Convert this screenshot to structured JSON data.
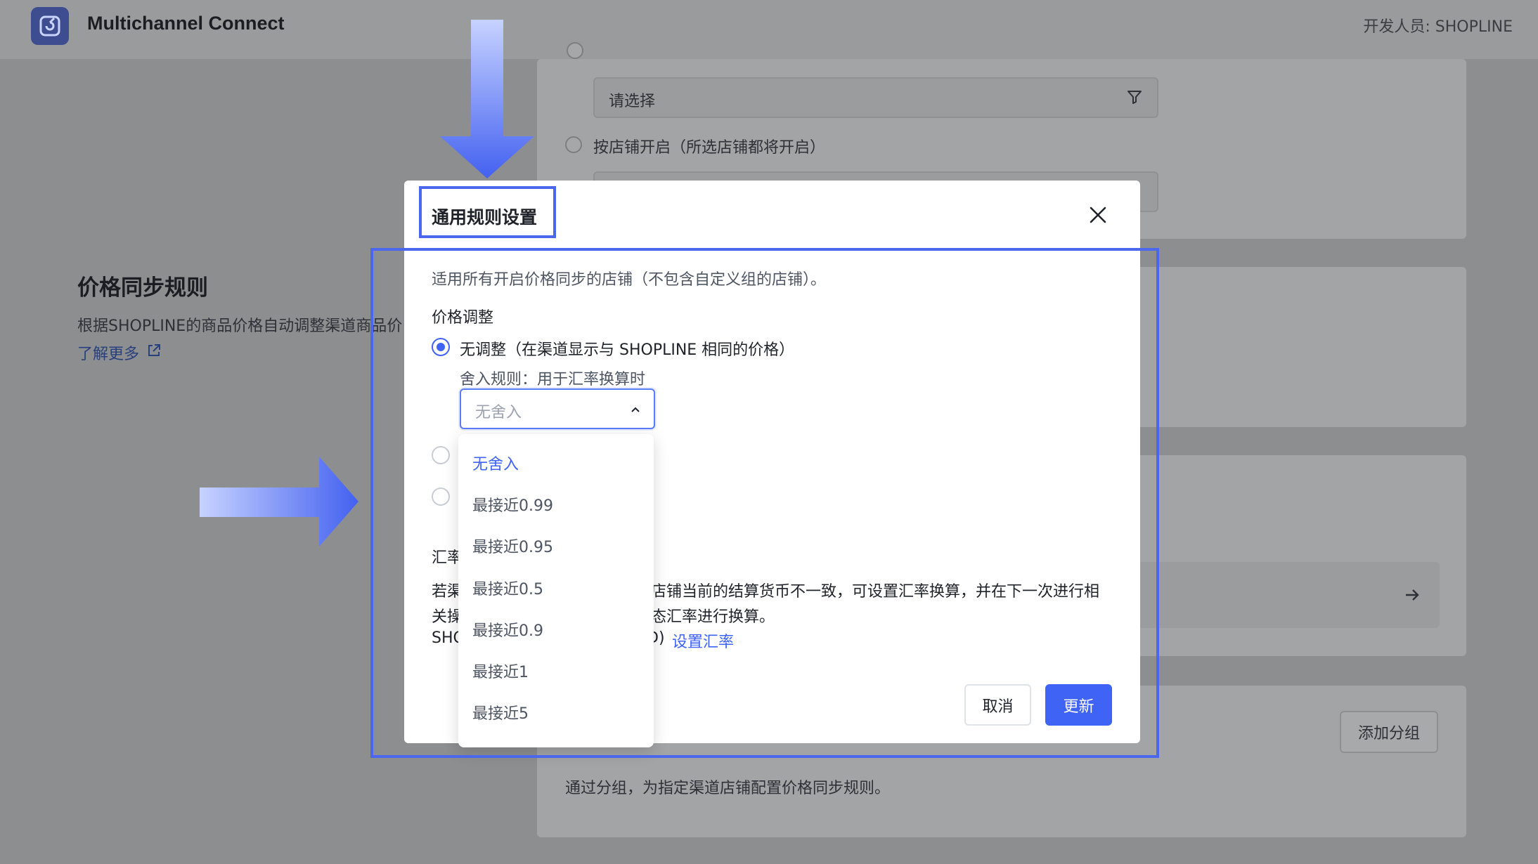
{
  "app": {
    "title": "Multichannel Connect",
    "developer_label": "开发人员: SHOPLINE"
  },
  "background": {
    "filter_placeholder": "请选择",
    "store_radio_label": "按店铺开启（所选店铺都将开启）",
    "section_title": "价格同步规则",
    "section_desc": "根据SHOPLINE的商品价格自动调整渠道商品价",
    "learn_more": "了解更多",
    "add_group_button": "添加分组",
    "group_desc": "通过分组，为指定渠道店铺配置价格同步规则。"
  },
  "modal": {
    "title": "通用规则设置",
    "intro": "适用所有开启价格同步的店铺（不包含自定义组的店铺）。",
    "price_adjust_label": "价格调整",
    "no_adjust_option": "无调整（在渠道显示与 SHOPLINE 相同的价格）",
    "rounding_label": "舍入规则：用于汇率换算时",
    "rounding_value": "无舍入",
    "exchange_section_label": "汇率",
    "exchange_line1_left": "若渠",
    "exchange_line1_right": "店铺当前的结算货币不一致，可设置汇率换算，并在下一次进行相",
    "exchange_line2_left": "关操",
    "exchange_line2_right": "态汇率进行换算。",
    "exchange_line3_left": "SHO",
    "exchange_line3_right": "D)",
    "set_rate_link": "设置汇率",
    "cancel_button": "取消",
    "update_button": "更新"
  },
  "dropdown": {
    "options": [
      "无舍入",
      "最接近0.99",
      "最接近0.95",
      "最接近0.5",
      "最接近0.9",
      "最接近1",
      "最接近5"
    ],
    "selected": "无舍入"
  },
  "colors": {
    "accent": "#3e63f5",
    "annotation": "#4a67ee"
  },
  "icons": [
    "logo-icon",
    "filter-icon",
    "external-link-icon",
    "close-icon",
    "chevron-up-icon",
    "arrow-right-icon",
    "annotation-arrow-down",
    "annotation-arrow-right"
  ]
}
